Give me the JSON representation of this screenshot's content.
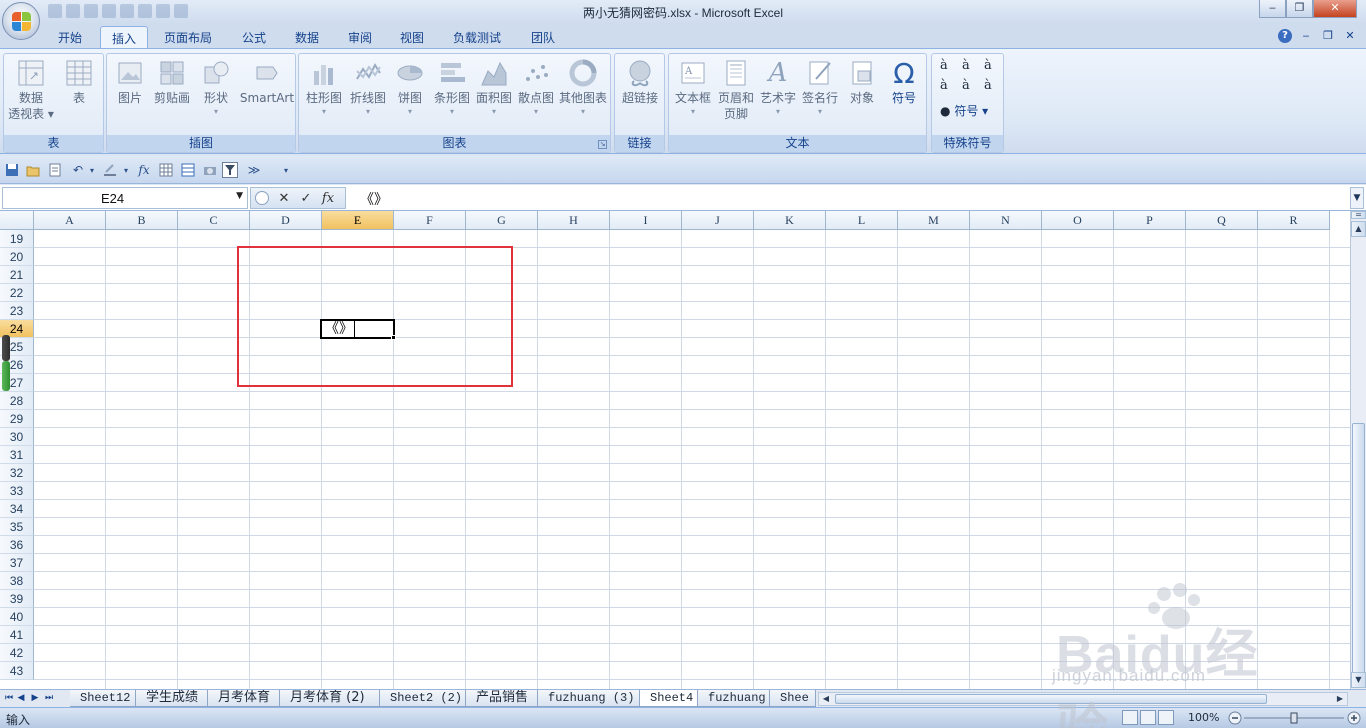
{
  "window": {
    "title": "两小无猜网密码.xlsx - Microsoft Excel"
  },
  "tabs": [
    {
      "label": "开始",
      "active": false
    },
    {
      "label": "插入",
      "active": true
    },
    {
      "label": "页面布局",
      "active": false
    },
    {
      "label": "公式",
      "active": false
    },
    {
      "label": "数据",
      "active": false
    },
    {
      "label": "审阅",
      "active": false
    },
    {
      "label": "视图",
      "active": false
    },
    {
      "label": "负载测试",
      "active": false
    },
    {
      "label": "团队",
      "active": false
    }
  ],
  "ribbon": {
    "groups": [
      {
        "label": "表",
        "buttons": [
          {
            "label": "数据",
            "label2": "透视表",
            "icon": "pivot-table-icon"
          },
          {
            "label": "表",
            "icon": "table-icon"
          }
        ]
      },
      {
        "label": "插图",
        "buttons": [
          {
            "label": "图片",
            "icon": "picture-icon"
          },
          {
            "label": "剪贴画",
            "icon": "clip-art-icon"
          },
          {
            "label": "形状",
            "icon": "shapes-icon"
          },
          {
            "label": "SmartArt",
            "icon": "smartart-icon"
          }
        ]
      },
      {
        "label": "图表",
        "buttons": [
          {
            "label": "柱形图",
            "icon": "column-chart-icon"
          },
          {
            "label": "折线图",
            "icon": "line-chart-icon"
          },
          {
            "label": "饼图",
            "icon": "pie-chart-icon"
          },
          {
            "label": "条形图",
            "icon": "bar-chart-icon"
          },
          {
            "label": "面积图",
            "icon": "area-chart-icon"
          },
          {
            "label": "散点图",
            "icon": "scatter-chart-icon"
          },
          {
            "label": "其他图表",
            "icon": "other-charts-icon"
          }
        ]
      },
      {
        "label": "链接",
        "buttons": [
          {
            "label": "超链接",
            "icon": "hyperlink-icon"
          }
        ]
      },
      {
        "label": "文本",
        "buttons": [
          {
            "label": "文本框",
            "icon": "text-box-icon"
          },
          {
            "label": "页眉和",
            "label2": "页脚",
            "icon": "header-footer-icon"
          },
          {
            "label": "艺术字",
            "icon": "wordart-icon"
          },
          {
            "label": "签名行",
            "icon": "signature-line-icon"
          },
          {
            "label": "对象",
            "icon": "object-icon"
          },
          {
            "label": "符号",
            "icon": "omega-icon"
          }
        ]
      },
      {
        "label": "特殊符号",
        "symbols": [
          "à",
          "à",
          "à",
          "à",
          "à",
          "à"
        ],
        "symbol_button": "符号"
      }
    ]
  },
  "formula_bar": {
    "name_box": "E24",
    "content": "《》"
  },
  "grid": {
    "columns": [
      "A",
      "B",
      "C",
      "D",
      "E",
      "F",
      "G",
      "H",
      "I",
      "J",
      "K",
      "L",
      "M",
      "N",
      "O",
      "P",
      "Q",
      "R"
    ],
    "rows": [
      "19",
      "20",
      "21",
      "22",
      "23",
      "24",
      "25",
      "26",
      "27",
      "28",
      "29",
      "30",
      "31",
      "32",
      "33",
      "34",
      "35",
      "36",
      "37",
      "38",
      "39",
      "40",
      "41",
      "42",
      "43"
    ],
    "selected_column": "E",
    "selected_row": "24",
    "active_cell_value": "《》"
  },
  "sheets": [
    {
      "name": "Sheet12",
      "active": false
    },
    {
      "name": "学生成绩",
      "active": false
    },
    {
      "name": "月考体育",
      "active": false
    },
    {
      "name": "月考体育 (2)",
      "active": false
    },
    {
      "name": "Sheet2 (2)",
      "active": false
    },
    {
      "name": "产品销售",
      "active": false
    },
    {
      "name": "fuzhuang (3)",
      "active": false
    },
    {
      "name": "Sheet4",
      "active": true
    },
    {
      "name": "fuzhuang",
      "active": false
    },
    {
      "name": "Shee",
      "active": false
    }
  ],
  "status": {
    "mode": "输入",
    "zoom": "100%"
  },
  "watermark": {
    "brand": "Baidu经验",
    "url": "jingyan.baidu.com"
  },
  "colors": {
    "highlight_box": "#e0323a",
    "selected_header": "#f1c15f",
    "ribbon_text": "#15428b"
  }
}
